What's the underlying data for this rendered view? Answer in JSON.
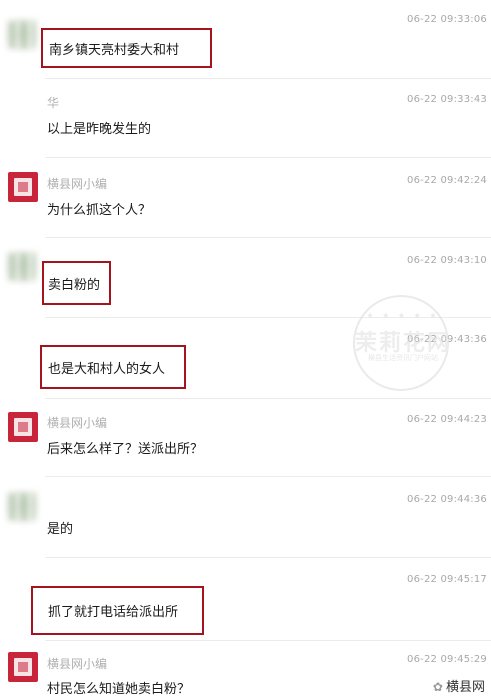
{
  "messages": [
    {
      "sender": "",
      "time": "06-22 09:33:06",
      "text": "南乡镇天亮村委大和村",
      "avatar": "blurred"
    },
    {
      "sender": "华",
      "time": "06-22 09:33:43",
      "text": "以上是昨晚发生的",
      "avatar": "none"
    },
    {
      "sender": "横县网小编",
      "time": "06-22 09:42:24",
      "text": "为什么抓这个人？",
      "avatar": "red-logo"
    },
    {
      "sender": "",
      "time": "06-22 09:43:10",
      "text": "卖白粉的",
      "avatar": "blurred"
    },
    {
      "sender": "",
      "time": "06-22 09:43:36",
      "text": "也是大和村人的女人",
      "avatar": "none"
    },
    {
      "sender": "横县网小编",
      "time": "06-22 09:44:23",
      "text": "后来怎么样了？送派出所？",
      "avatar": "red-logo"
    },
    {
      "sender": "",
      "time": "06-22 09:44:36",
      "text": "是的",
      "avatar": "blurred"
    },
    {
      "sender": "",
      "time": "06-22 09:45:17",
      "text": "抓了就打电话给派出所",
      "avatar": "none"
    },
    {
      "sender": "横县网小编",
      "time": "06-22 09:45:29",
      "text": "村民怎么知道她卖白粉？",
      "avatar": "red-logo"
    }
  ],
  "watermark": {
    "title": "茉莉花网",
    "subtitle": "横县生活资讯门户网站",
    "stars": "★ ★ ★ ★ ★"
  },
  "footer": {
    "brand": "横县网",
    "icon": "wechat-icon"
  },
  "colors": {
    "highlight_border": "#a3141e",
    "avatar_red": "#c8243a",
    "timestamp": "#a8a8a8"
  }
}
